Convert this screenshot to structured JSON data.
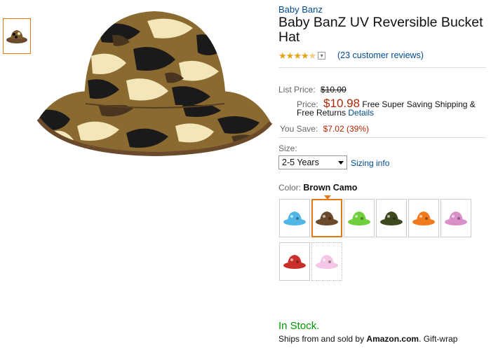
{
  "product": {
    "brand": "Baby Banz",
    "title": "Baby BanZ UV Reversible Bucket Hat",
    "rating_stars": 4.5,
    "rating_icon": "star-rating-icon",
    "reviews_link": "23 customer reviews",
    "reviews_open": "(",
    "reviews_close": ")"
  },
  "pricing": {
    "list_price_label": "List Price:",
    "list_price_value": "$10.00",
    "price_label": "Price:",
    "price_value": "$10.98",
    "shipping_text": "Free Super Saving Shipping & Free Returns",
    "details_link": "Details",
    "you_save_label": "You Save:",
    "you_save_value": "$7.02 (39%)"
  },
  "size": {
    "label": "Size:",
    "selected": "2-5 Years",
    "sizing_link": "Sizing info"
  },
  "color": {
    "label": "Color:",
    "selected": "Brown Camo",
    "swatches": [
      {
        "name": "Blue",
        "hex": "#4fb6e6"
      },
      {
        "name": "Brown Camo",
        "hex": "#6b4a2b"
      },
      {
        "name": "Green",
        "hex": "#6fcf3a"
      },
      {
        "name": "Green Camo",
        "hex": "#3d4a1e"
      },
      {
        "name": "Orange",
        "hex": "#f07a1d"
      },
      {
        "name": "Pink",
        "hex": "#d98fc8"
      },
      {
        "name": "Red",
        "hex": "#c9302c"
      },
      {
        "name": "Light Pink",
        "hex": "#f4c5e4"
      }
    ]
  },
  "availability": {
    "stock": "In Stock.",
    "ships_prefix": "Ships from and sold by",
    "seller": "Amazon.com",
    "ships_suffix": ". Gift-wrap"
  },
  "colors": {
    "link": "#004b91",
    "price_red": "#b12704",
    "in_stock_green": "#009900",
    "accent_orange": "#e47911"
  }
}
